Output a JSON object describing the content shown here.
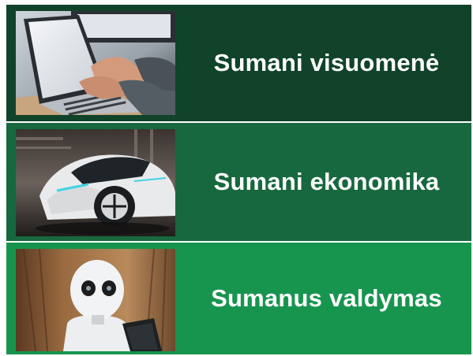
{
  "colors": {
    "tile_1": "#10432a",
    "tile_2": "#17683e",
    "tile_3": "#17954f",
    "label_text": "#ffffff"
  },
  "tiles": [
    {
      "label": "Sumani visuomenė",
      "image": "laptop-typing-photo"
    },
    {
      "label": "Sumani ekonomika",
      "image": "concept-car-photo"
    },
    {
      "label": "Sumanus valdymas",
      "image": "humanoid-robot-photo"
    }
  ]
}
